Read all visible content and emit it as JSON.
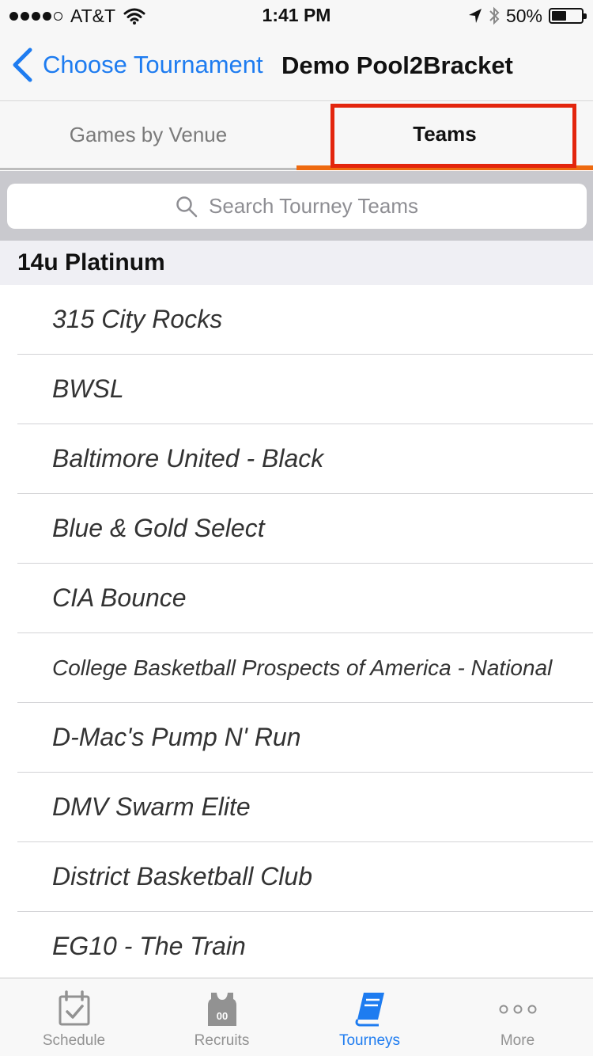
{
  "status_bar": {
    "carrier": "AT&T",
    "time": "1:41 PM",
    "battery_percent": "50%",
    "battery_level": 0.5,
    "signal_bars": 4,
    "signal_total": 5
  },
  "nav": {
    "back_label": "Choose Tournament",
    "title": "Demo Pool2Bracket"
  },
  "tabs": {
    "venue_label": "Games by Venue",
    "teams_label": "Teams",
    "selected": "Teams"
  },
  "search": {
    "placeholder": "Search Tourney Teams"
  },
  "section": {
    "title": "14u Platinum"
  },
  "teams": [
    "315 City Rocks",
    "BWSL",
    "Baltimore United - Black",
    "Blue & Gold Select",
    "CIA Bounce",
    "College Basketball Prospects of America - National",
    "D-Mac's Pump N' Run",
    "DMV Swarm Elite",
    "District Basketball Club",
    "EG10 - The Train"
  ],
  "tab_bar": {
    "items": [
      {
        "label": "Schedule",
        "icon": "calendar-check-icon"
      },
      {
        "label": "Recruits",
        "icon": "jersey-icon",
        "icon_text": "00"
      },
      {
        "label": "Tourneys",
        "icon": "book-icon"
      },
      {
        "label": "More",
        "icon": "more-dots-icon"
      }
    ],
    "active": "Tourneys"
  },
  "colors": {
    "accent_blue": "#1e7cf0",
    "tab_underline_orange": "#ee6a10",
    "highlight_red": "#e3250d"
  }
}
